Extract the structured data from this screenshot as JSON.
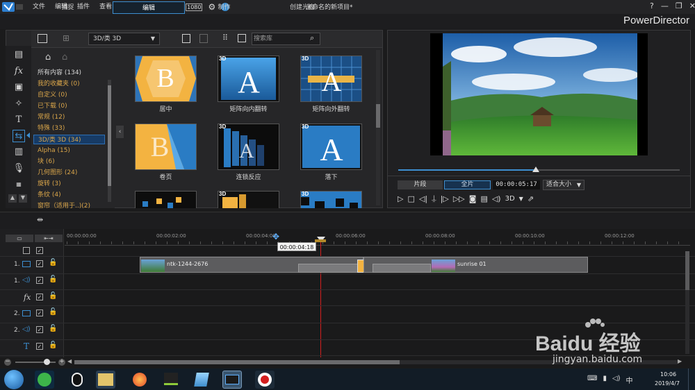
{
  "app": {
    "menu": [
      "文件",
      "编辑",
      "插件",
      "查看",
      "播放"
    ],
    "title": "未命名的新项目*",
    "brand": "PowerDirector",
    "help": "?"
  },
  "mode_tabs": [
    "捕捉",
    "编辑",
    "制作",
    "创建光盘"
  ],
  "library": {
    "category_select": "3D/类 3D",
    "search_placeholder": "搜索库",
    "categories": [
      "所有内容 (134)",
      "我的收藏夹 (0)",
      "自定义 (0)",
      "已下载 (0)",
      "常规 (12)",
      "特殊 (33)",
      "3D/类 3D (34)",
      "Alpha (15)",
      "块 (6)",
      "几何图形 (24)",
      "旋转 (3)",
      "条纹 (4)",
      "窗帘（适用于..)(2)"
    ],
    "transitions": [
      {
        "label": "居中",
        "badge": ""
      },
      {
        "label": "矩阵向内翻转",
        "badge": "3D"
      },
      {
        "label": "矩阵向外翻转",
        "badge": "3D"
      },
      {
        "label": "卷页",
        "badge": ""
      },
      {
        "label": "连锁反应",
        "badge": "3D"
      },
      {
        "label": "落下",
        "badge": "3D"
      }
    ],
    "row3_badges": [
      "3D",
      "3D"
    ]
  },
  "preview": {
    "clip_button": "片段",
    "movie_button": "全片",
    "timecode": "00:00:05:17",
    "fit": "适合大小",
    "mode_3d": "3D"
  },
  "timeline": {
    "ruler": [
      "00:00:00:00",
      "00:00:02:00",
      "00:00:04:00",
      "00:00:06:00",
      "00:00:08:00",
      "00:00:10:00",
      "00:00:12:00"
    ],
    "playhead_tooltip": "00:00:04:18",
    "clips": [
      "ntk-1244-2676",
      "sunrise 01"
    ],
    "tracks": [
      "1.",
      "1.",
      "fx",
      "2.",
      "2.",
      "T"
    ]
  },
  "taskbar": {
    "time": "10:06",
    "date": "2019/4/7"
  },
  "watermark": {
    "text": "jingyan.baidu.com",
    "logo_text": "Baidu 经验"
  },
  "colors": {
    "accent": "#3d8fd1",
    "category": "#d9a54a",
    "playhead": "#d41f1f"
  }
}
